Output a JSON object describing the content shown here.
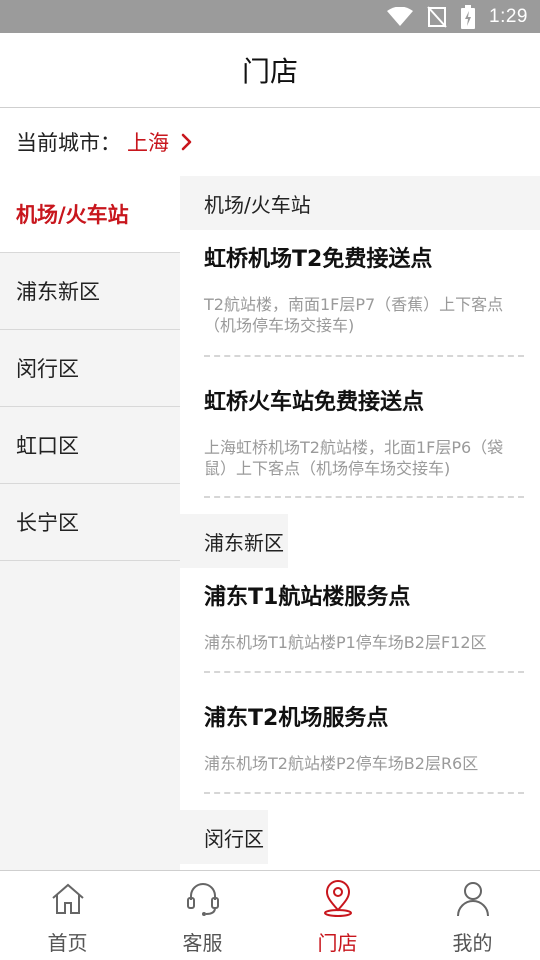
{
  "status_bar": {
    "time": "1:29"
  },
  "header": {
    "title": "门店"
  },
  "city": {
    "label": "当前城市：",
    "value": "上海"
  },
  "sidebar": {
    "items": [
      {
        "label": "机场/火车站",
        "active": true
      },
      {
        "label": "浦东新区",
        "active": false
      },
      {
        "label": "闵行区",
        "active": false
      },
      {
        "label": "虹口区",
        "active": false
      },
      {
        "label": "长宁区",
        "active": false
      }
    ]
  },
  "sections": [
    {
      "title": "机场/火车站",
      "stores": [
        {
          "name": "虹桥机场T2免费接送点",
          "address": "T2航站楼，南面1F层P7（香蕉）上下客点（机场停车场交接车)"
        },
        {
          "name": "虹桥火车站免费接送点",
          "address": "上海虹桥机场T2航站楼，北面1F层P6（袋鼠）上下客点（机场停车场交接车)"
        }
      ]
    },
    {
      "title": "浦东新区",
      "stores": [
        {
          "name": "浦东T1航站楼服务点",
          "address": "浦东机场T1航站楼P1停车场B2层F12区"
        },
        {
          "name": "浦东T2机场服务点",
          "address": "浦东机场T2航站楼P2停车场B2层R6区"
        }
      ]
    },
    {
      "title": "闵行区",
      "stores": []
    }
  ],
  "tabbar": {
    "items": [
      {
        "label": "首页",
        "icon": "home-icon",
        "active": false
      },
      {
        "label": "客服",
        "icon": "headset-icon",
        "active": false
      },
      {
        "label": "门店",
        "icon": "location-pin-icon",
        "active": true
      },
      {
        "label": "我的",
        "icon": "user-icon",
        "active": false
      }
    ]
  },
  "colors": {
    "accent": "#c8161d",
    "sidebar_bg": "#f4f4f4",
    "status_bar": "#9b9b9b"
  }
}
